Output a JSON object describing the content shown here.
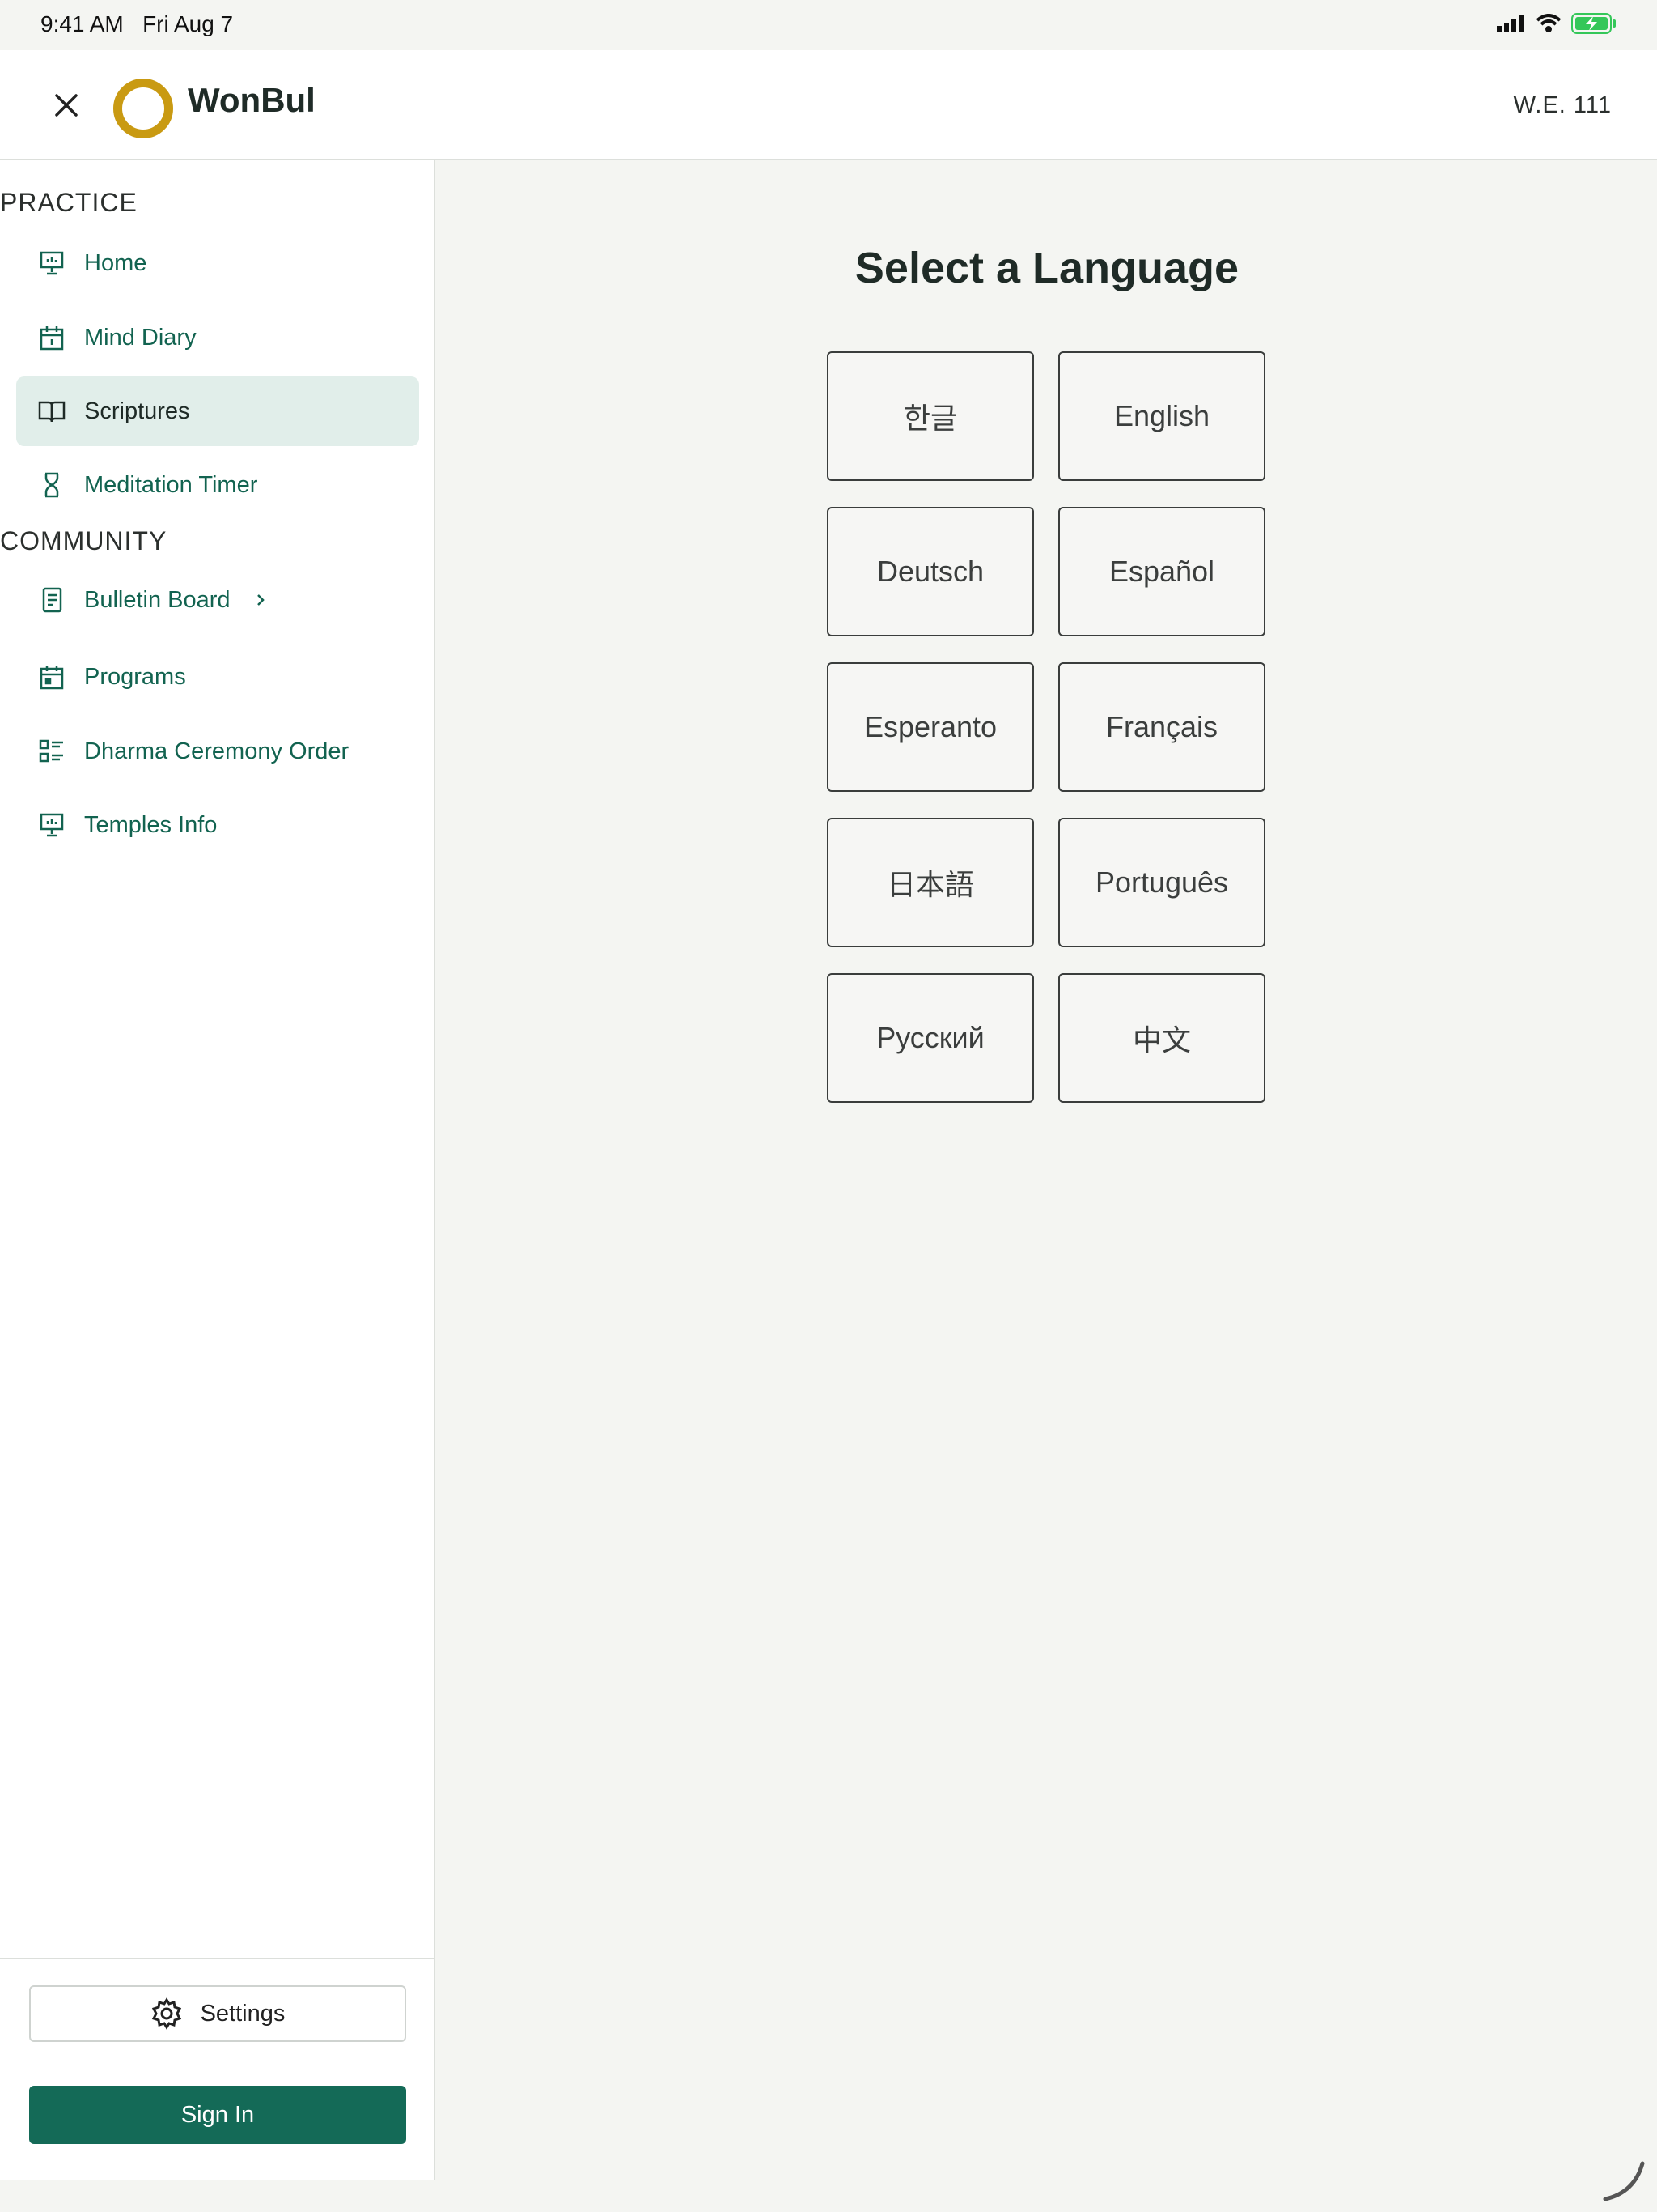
{
  "status_bar": {
    "time": "9:41 AM",
    "date": "Fri Aug 7",
    "icons": [
      "signal-icon",
      "wifi-icon",
      "battery-charging-icon"
    ],
    "battery_color": "#34c759"
  },
  "header": {
    "app_title": "WonBul",
    "era_label": "W.E. 111",
    "close_icon": "close-icon",
    "logo_color": "#c99a12"
  },
  "sidebar": {
    "practice_heading": "PRACTICE",
    "community_heading": "COMMUNITY",
    "practice_items": [
      {
        "label": "Home",
        "icon": "presentation-icon"
      },
      {
        "label": "Mind Diary",
        "icon": "calendar-icon"
      },
      {
        "label": "Scriptures",
        "icon": "book-open-icon",
        "active": true
      },
      {
        "label": "Meditation Timer",
        "icon": "hourglass-icon"
      }
    ],
    "community_items": [
      {
        "label": "Bulletin Board",
        "icon": "document-icon",
        "has_chevron": true
      },
      {
        "label": "Programs",
        "icon": "calendar-icon"
      },
      {
        "label": "Dharma Ceremony Order",
        "icon": "list-icon"
      },
      {
        "label": "Temples Info",
        "icon": "presentation-icon"
      }
    ],
    "settings_label": "Settings",
    "sign_in_label": "Sign In",
    "accent_color": "#146a57"
  },
  "main": {
    "title": "Select a Language",
    "languages": [
      "한글",
      "English",
      "Deutsch",
      "Español",
      "Esperanto",
      "Français",
      "日本語",
      "Português",
      "Русский",
      "中文"
    ]
  }
}
